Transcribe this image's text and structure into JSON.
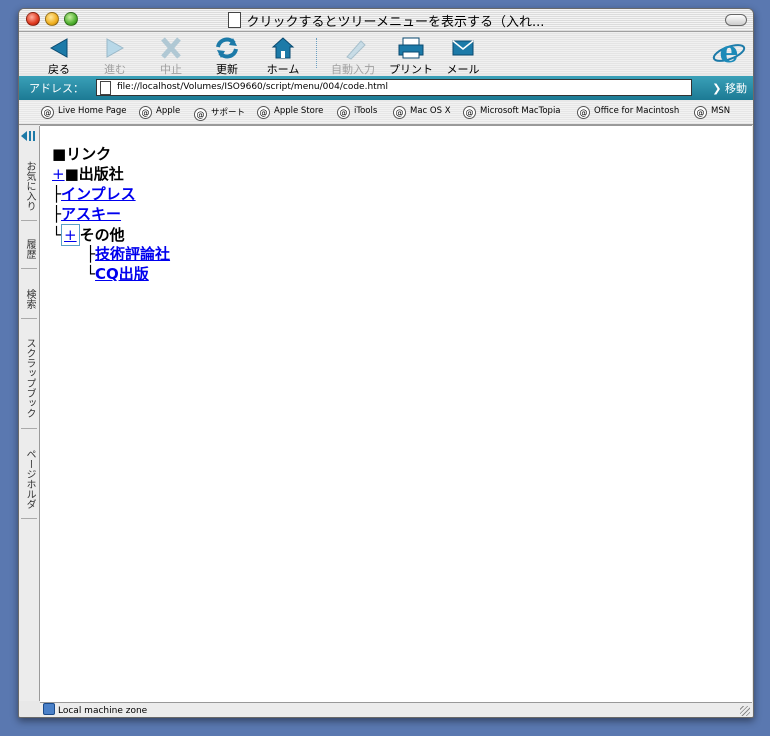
{
  "window": {
    "title": "クリックするとツリーメニューを表示する（入れ..."
  },
  "toolbar": {
    "back": "戻る",
    "forward": "進む",
    "stop": "中止",
    "refresh": "更新",
    "home": "ホーム",
    "autofill": "自動入力",
    "print": "プリント",
    "mail": "メール"
  },
  "address": {
    "label": "アドレス：",
    "url": "file://localhost/Volumes/ISO9660/script/menu/004/code.html",
    "go": "移動"
  },
  "favorites": [
    "Live Home Page",
    "Apple",
    "サポート",
    "Apple Store",
    "iTools",
    "Mac OS X",
    "Microsoft MacTopia",
    "Office for Macintosh",
    "MSN"
  ],
  "sidebar": {
    "tabs": [
      "お気に入り",
      "履歴",
      "検索",
      "スクラップブック",
      "ページホルダ"
    ]
  },
  "tree": {
    "heading": "■リンク",
    "plus": "+",
    "publishers": "■出版社",
    "connectors": {
      "mid": "├",
      "last": "└"
    },
    "items": [
      "インプレス",
      "アスキー"
    ],
    "other": "その他",
    "sub_items": [
      "技術評論社",
      "CQ出版"
    ]
  },
  "status": {
    "zone": "Local machine zone"
  },
  "colors": {
    "link": "#0000ee",
    "address_bar": "#1c7a94",
    "desktop": "#5a78b0"
  }
}
